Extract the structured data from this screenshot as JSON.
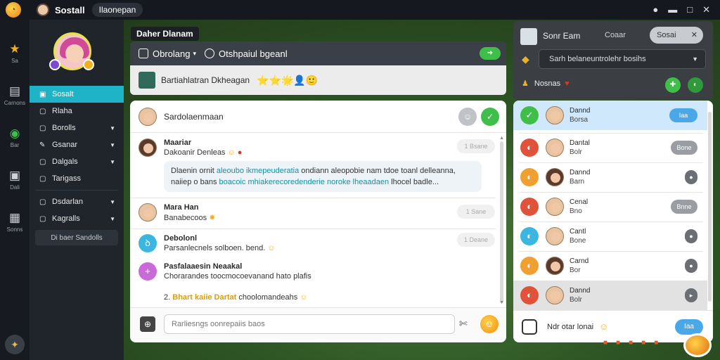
{
  "app": {
    "title": "Sostall",
    "tab": "Ilaonepan"
  },
  "rail": [
    {
      "icon": "star-icon",
      "label": "Sa"
    },
    {
      "icon": "doc-icon",
      "label": "Carnons"
    },
    {
      "icon": "globe-icon",
      "label": "Bar"
    },
    {
      "icon": "chat-icon",
      "label": "Dali"
    },
    {
      "icon": "box-icon",
      "label": "Sonns"
    }
  ],
  "sidebar": {
    "items": [
      {
        "label": "Sosalt",
        "active": true
      },
      {
        "label": "Rlaha"
      },
      {
        "label": "Borolls",
        "caret": true
      },
      {
        "label": "Gsanar",
        "caret": true
      },
      {
        "label": "Dalgals",
        "caret": true
      },
      {
        "label": "Tarigass"
      },
      {
        "label": "Dsdarlan",
        "caret": true
      },
      {
        "label": "Kagralls",
        "caret": true
      }
    ],
    "footer": "Di baer Sandolls"
  },
  "breadcrumb": "Daher Dlanam",
  "chat": {
    "header": {
      "tab1": "Obrolang",
      "tab1_caret": "▾",
      "tab2": "Otshpaiul bgeanl"
    },
    "sub": {
      "title": "Bartiahlatran Dkheagan",
      "emoji": "⭐⭐🌟👤🙂"
    },
    "top": {
      "name": "Sardolaenmaan"
    },
    "messages": [
      {
        "name": "Maariar",
        "text": "Dakoanir Denleas",
        "seen": "1 Bsane",
        "quote_line1_a": "Dlaenin ornit ",
        "quote_line1_b": "aleoubo ikmepeuderatia",
        "quote_line1_c": " ondiann aleopobie nam tdoe toanl delleanna,",
        "quote_line2_a": "naiiep o bans  ",
        "quote_line2_b": "boacoic mhiakerecoredenderie",
        "quote_line2_c": "  noroke lheaadaen",
        "quote_line2_d": "  lhocel badle..."
      },
      {
        "name": "Mara Han",
        "text": "Banabecoos",
        "seen": "1 Sane"
      },
      {
        "name": "Debolonl",
        "text": "Parsanlecnels solboen. bend.",
        "seen": "1 Deane"
      },
      {
        "name": "Pasfalaaesin Neaakal",
        "text": "Chorarandes  toocmocoevanand  hato plafis"
      },
      {
        "prefix": "2.",
        "highlight": "Bhart kaiie Dartat",
        "text": "choolomandeahs"
      }
    ],
    "input_placeholder": "Rarliesngs oonrepaiis baos"
  },
  "right_panel": {
    "name": "Sonr Eam",
    "group": "Coaar",
    "chip": "Sosai",
    "select": "Sarh belaneuntrolehr bosihs",
    "row2": "Nosnas"
  },
  "members": [
    {
      "l1": "Dannd",
      "l2": "Borsa",
      "action": "Iaa",
      "style": "blue",
      "icon_color": "#3fbf4a",
      "icon": "✓",
      "highlight": true
    },
    {
      "l1": "Dantal",
      "l2": "Bolr",
      "action": "Bone",
      "style": "grey",
      "icon_color": "#e0523a",
      "icon": "◐"
    },
    {
      "l1": "Dannd",
      "l2": "Barn",
      "action": "●",
      "style": "dot",
      "icon_color": "#f0a030",
      "icon": "◐"
    },
    {
      "l1": "Cenal",
      "l2": "Bno",
      "action": "Bnne",
      "style": "grey",
      "icon_color": "#e0523a",
      "icon": "◐"
    },
    {
      "l1": "Cantl",
      "l2": "Bone",
      "action": "●",
      "style": "dot",
      "icon_color": "#3ab6e0",
      "icon": "◐"
    },
    {
      "l1": "Carnd",
      "l2": "Bor",
      "action": "●",
      "style": "dot",
      "icon_color": "#f0a030",
      "icon": "◐"
    },
    {
      "l1": "Dannd",
      "l2": "Bolr",
      "action": "▸",
      "style": "dot",
      "icon_color": "#e0523a",
      "icon": "◐",
      "selected": true
    }
  ],
  "members_footer": {
    "text": "Ndr otar lonai",
    "button": "Iaa"
  }
}
